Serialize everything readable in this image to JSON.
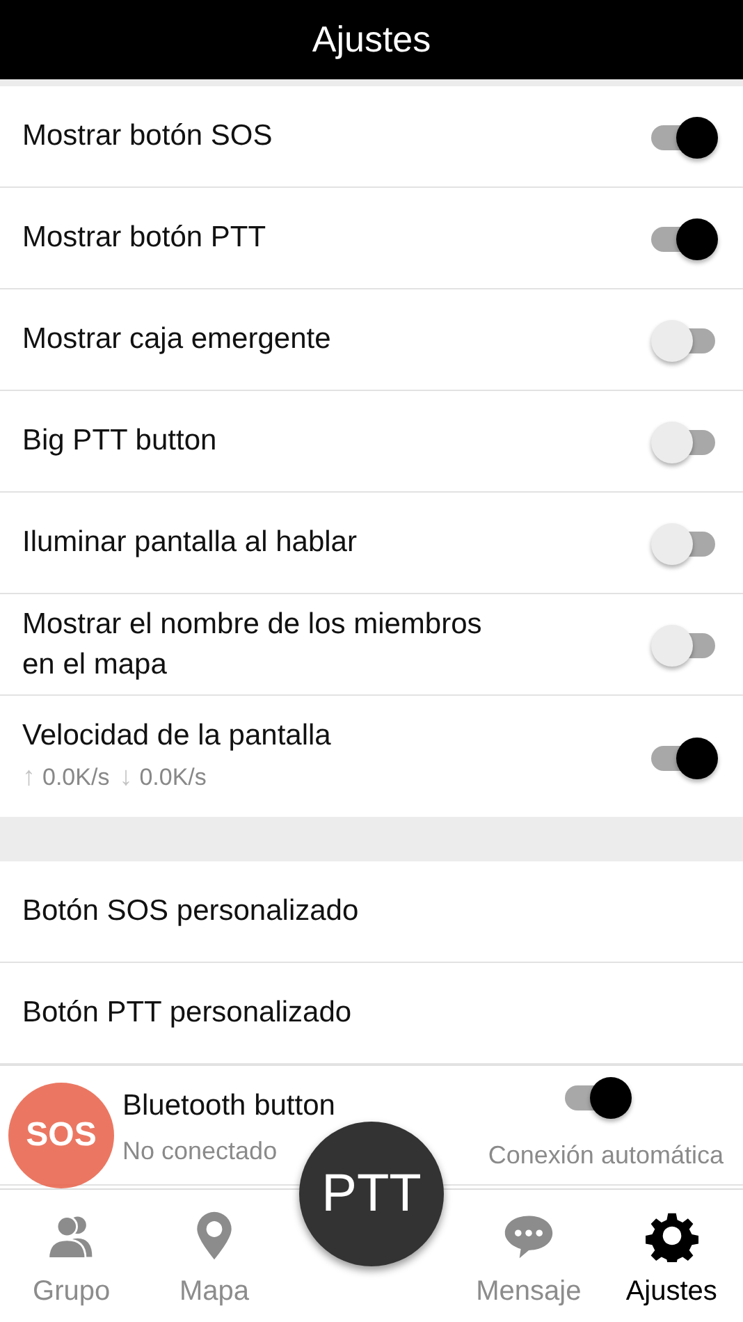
{
  "header": {
    "title": "Ajustes"
  },
  "settings": [
    {
      "kind": "toggle",
      "label": "Mostrar botón SOS",
      "on": true
    },
    {
      "kind": "toggle",
      "label": "Mostrar botón PTT",
      "on": true
    },
    {
      "kind": "toggle",
      "label": "Mostrar caja emergente",
      "on": false
    },
    {
      "kind": "toggle",
      "label": "Big PTT button",
      "on": false
    },
    {
      "kind": "toggle",
      "label": "Iluminar pantalla al hablar",
      "on": false
    },
    {
      "kind": "toggle",
      "label": "Mostrar el nombre de los miembros en el mapa",
      "on": false
    },
    {
      "kind": "speed",
      "label": "Velocidad de la pantalla",
      "on": true,
      "speeds": [
        {
          "arrow": "↑",
          "value": "0.0K/s"
        },
        {
          "arrow": "↓",
          "value": "0.0K/s"
        }
      ]
    }
  ],
  "more_settings": [
    {
      "kind": "link",
      "label": "Botón SOS personalizado"
    },
    {
      "kind": "link",
      "label": "Botón PTT personalizado"
    },
    {
      "kind": "bluetooth",
      "label": "Bluetooth button",
      "status": "No conectado",
      "on": true,
      "option": "Conexión automática"
    }
  ],
  "sos_button": {
    "label": "SOS"
  },
  "ptt_button": {
    "label": "PTT"
  },
  "nav": [
    {
      "kind": "group",
      "label": "Grupo",
      "selected": false
    },
    {
      "kind": "map",
      "label": "Mapa",
      "selected": false
    },
    {
      "kind": "message",
      "label": "Mensaje",
      "selected": false
    },
    {
      "kind": "settings",
      "label": "Ajustes",
      "selected": true
    }
  ]
}
